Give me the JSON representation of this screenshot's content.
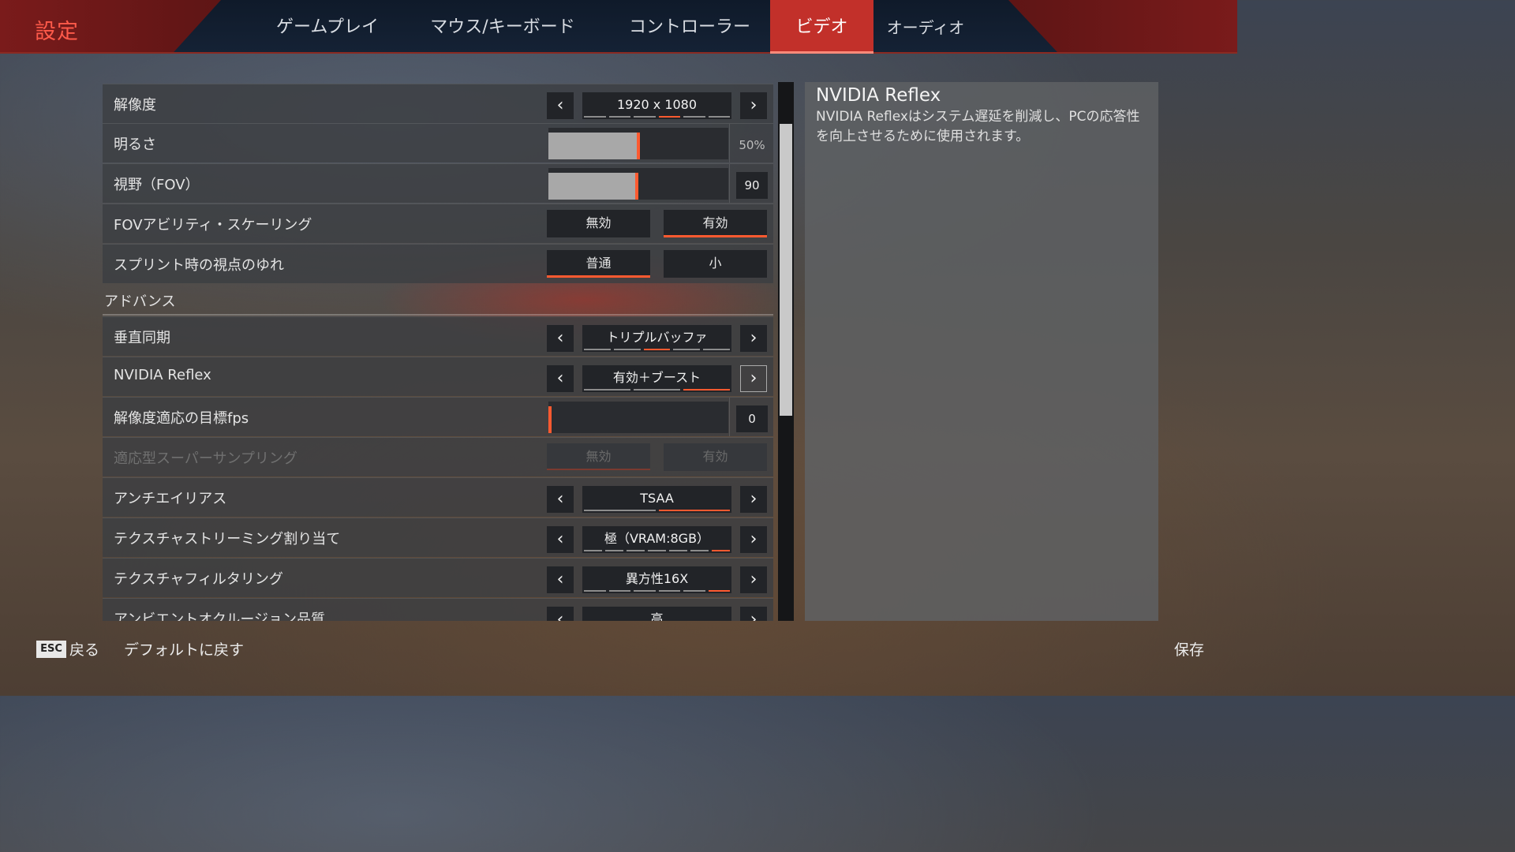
{
  "title": "設定",
  "tabs": [
    {
      "label": "ゲームプレイ"
    },
    {
      "label": "マウス/キーボード"
    },
    {
      "label": "コントローラー"
    },
    {
      "label": "ビデオ",
      "active": true
    },
    {
      "label": "オーディオ"
    }
  ],
  "settings": {
    "resolution": {
      "label": "解像度",
      "value": "1920 x 1080",
      "pips_total": 6,
      "pip_active": 4
    },
    "brightness": {
      "label": "明るさ",
      "value": "50%",
      "level_percent": 50
    },
    "fov": {
      "label": "視野（FOV）",
      "value": "90",
      "level_percent": 49
    },
    "fov_scaling": {
      "label": "FOVアビリティ・スケーリング",
      "option_a": "無効",
      "option_b": "有効",
      "selected": "有効"
    },
    "sprint_shake": {
      "label": "スプリント時の視点のゆれ",
      "option_a": "普通",
      "option_b": "小",
      "selected": "普通"
    },
    "advanced_header": "アドバンス",
    "vsync": {
      "label": "垂直同期",
      "value": "トリプルバッファ",
      "pips_total": 5,
      "pip_active": 3
    },
    "nvidia_reflex": {
      "label": "NVIDIA Reflex",
      "value": "有効＋ブースト",
      "pips_total": 3,
      "pip_active": 3
    },
    "adaptive_fps": {
      "label": "解像度適応の目標fps",
      "value": "0",
      "level_percent": 0
    },
    "adaptive_ss": {
      "label": "適応型スーパーサンプリング",
      "option_a": "無効",
      "option_b": "有効",
      "selected": "無効",
      "disabled": true
    },
    "anti_aliasing": {
      "label": "アンチエイリアス",
      "value": "TSAA",
      "pips_total": 2,
      "pip_active": 2
    },
    "texture_streaming": {
      "label": "テクスチャストリーミング割り当て",
      "value": "極（VRAM:8GB）",
      "pips_total": 7,
      "pip_active": 7
    },
    "texture_filtering": {
      "label": "テクスチャフィルタリング",
      "value": "異方性16X",
      "pips_total": 6,
      "pip_active": 6
    },
    "ambient_occlusion": {
      "label": "アンビエントオクルージョン品質",
      "value": "高"
    }
  },
  "description": {
    "title": "NVIDIA Reflex",
    "text": "NVIDIA Reflexはシステム遅延を削減し、PCの応答性を向上させるために使用されます。"
  },
  "footer": {
    "esc_key": "ESC",
    "back": "戻る",
    "reset": "デフォルトに戻す",
    "save": "保存"
  },
  "colors": {
    "accent": "#ff5a30",
    "title_red": "#ff5a4a",
    "tab_active": "#c2302a"
  },
  "icons": {
    "arrow_left": "chevron-left-icon",
    "arrow_right": "chevron-right-icon"
  }
}
